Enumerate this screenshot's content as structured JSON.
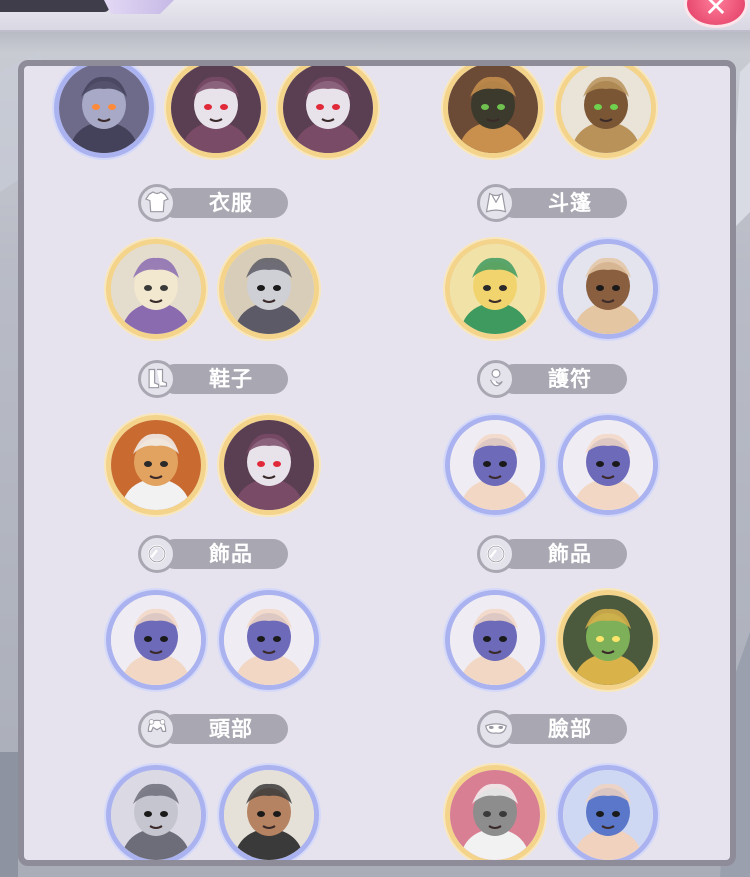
{
  "window": {
    "close_icon": "close-icon",
    "close_glyph": "✕"
  },
  "colors": {
    "panel_bg": "#e6e3ee",
    "panel_border": "#8f8c9a",
    "label_pill": "#a9a7b1",
    "frame_gold": "#f3d48a",
    "frame_blue": "#aab3f0"
  },
  "equipment": {
    "left_top_heroes": [
      {
        "name": "armored-robot-hero",
        "frame": "blue"
      },
      {
        "name": "white-dragon-hero",
        "frame": "gold"
      },
      {
        "name": "white-dragon-hero",
        "frame": "gold"
      }
    ],
    "right_top_heroes": [
      {
        "name": "goggles-machine-hero",
        "frame": "gold"
      },
      {
        "name": "eye-staff-hero",
        "frame": "gold"
      }
    ],
    "slots": [
      {
        "label": "衣服",
        "icon": "shirt-icon",
        "heroes": [
          {
            "name": "white-beard-elder-hero",
            "frame": "gold"
          },
          {
            "name": "masked-knight-hero",
            "frame": "gold"
          }
        ]
      },
      {
        "label": "斗篷",
        "icon": "cape-icon",
        "heroes": [
          {
            "name": "blonde-elf-hero",
            "frame": "gold"
          },
          {
            "name": "monkey-hero",
            "frame": "blue"
          }
        ]
      },
      {
        "label": "鞋子",
        "icon": "boots-icon",
        "heroes": [
          {
            "name": "tiger-gangster-hero",
            "frame": "gold"
          },
          {
            "name": "white-dragon-hero",
            "frame": "gold"
          }
        ]
      },
      {
        "label": "護符",
        "icon": "amulet-icon",
        "heroes": [
          {
            "name": "purple-hair-girl-hero",
            "frame": "blue"
          },
          {
            "name": "purple-hair-girl-hero",
            "frame": "blue"
          }
        ]
      },
      {
        "label": "飾品",
        "icon": "ring-icon",
        "heroes": [
          {
            "name": "purple-hair-girl-hero",
            "frame": "blue"
          },
          {
            "name": "purple-hair-girl-hero",
            "frame": "blue"
          }
        ]
      },
      {
        "label": "飾品",
        "icon": "ring-icon",
        "heroes": [
          {
            "name": "purple-hair-girl-hero",
            "frame": "blue"
          },
          {
            "name": "green-demon-hero",
            "frame": "gold"
          }
        ]
      },
      {
        "label": "頭部",
        "icon": "helmet-icon",
        "heroes": [
          {
            "name": "silver-helmet-hero",
            "frame": "blue"
          },
          {
            "name": "boar-boss-hero",
            "frame": "blue"
          }
        ]
      },
      {
        "label": "臉部",
        "icon": "mask-icon",
        "heroes": [
          {
            "name": "pink-robot-hero",
            "frame": "gold"
          },
          {
            "name": "blue-hair-fighter-hero",
            "frame": "blue"
          }
        ]
      }
    ]
  }
}
